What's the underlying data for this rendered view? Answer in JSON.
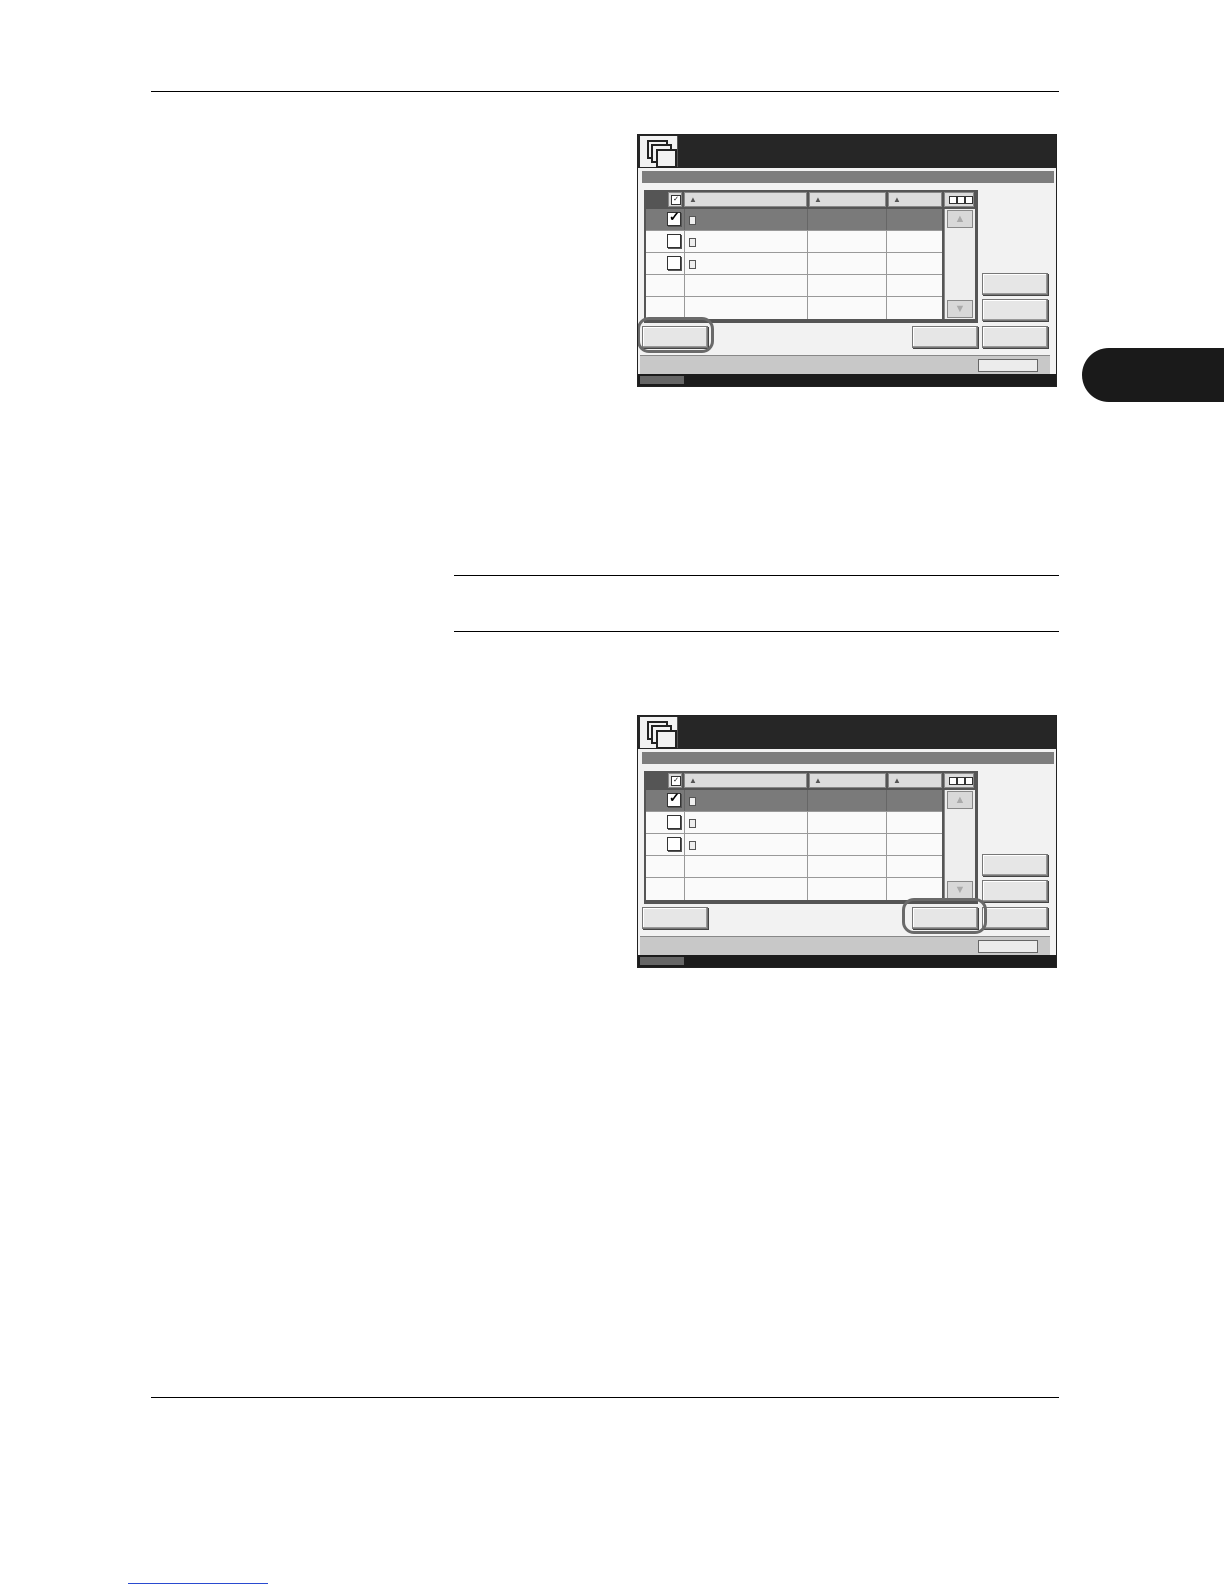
{
  "page": {
    "section_tab_label": "",
    "note_text": "",
    "footer_text": ""
  },
  "panels": [
    {
      "name": "panel-step-1",
      "highlighted_button": "left-bottom-button",
      "rows": [
        {
          "checked": true,
          "selected": true,
          "has_doc": true
        },
        {
          "checked": false,
          "selected": false,
          "has_doc": true
        },
        {
          "checked": false,
          "selected": false,
          "has_doc": true
        },
        {
          "checked": null,
          "selected": false,
          "has_doc": false
        },
        {
          "checked": null,
          "selected": false,
          "has_doc": false
        }
      ]
    },
    {
      "name": "panel-step-2",
      "highlighted_button": "bottom-middle-button",
      "rows": [
        {
          "checked": true,
          "selected": true,
          "has_doc": true
        },
        {
          "checked": false,
          "selected": false,
          "has_doc": true
        },
        {
          "checked": false,
          "selected": false,
          "has_doc": true
        },
        {
          "checked": null,
          "selected": false,
          "has_doc": false
        },
        {
          "checked": null,
          "selected": false,
          "has_doc": false
        }
      ]
    }
  ],
  "icons": {
    "app": "document-box-icon",
    "sort": "sort-triangle-icon",
    "scroll_up": "scroll-up-icon",
    "scroll_down": "scroll-down-icon",
    "check": "checkmark-icon"
  },
  "colors": {
    "titlebar": "#262626",
    "selected_row": "#7a7a7a",
    "callout": "#6a6a6a",
    "side_tab": "#1a1a1a"
  }
}
